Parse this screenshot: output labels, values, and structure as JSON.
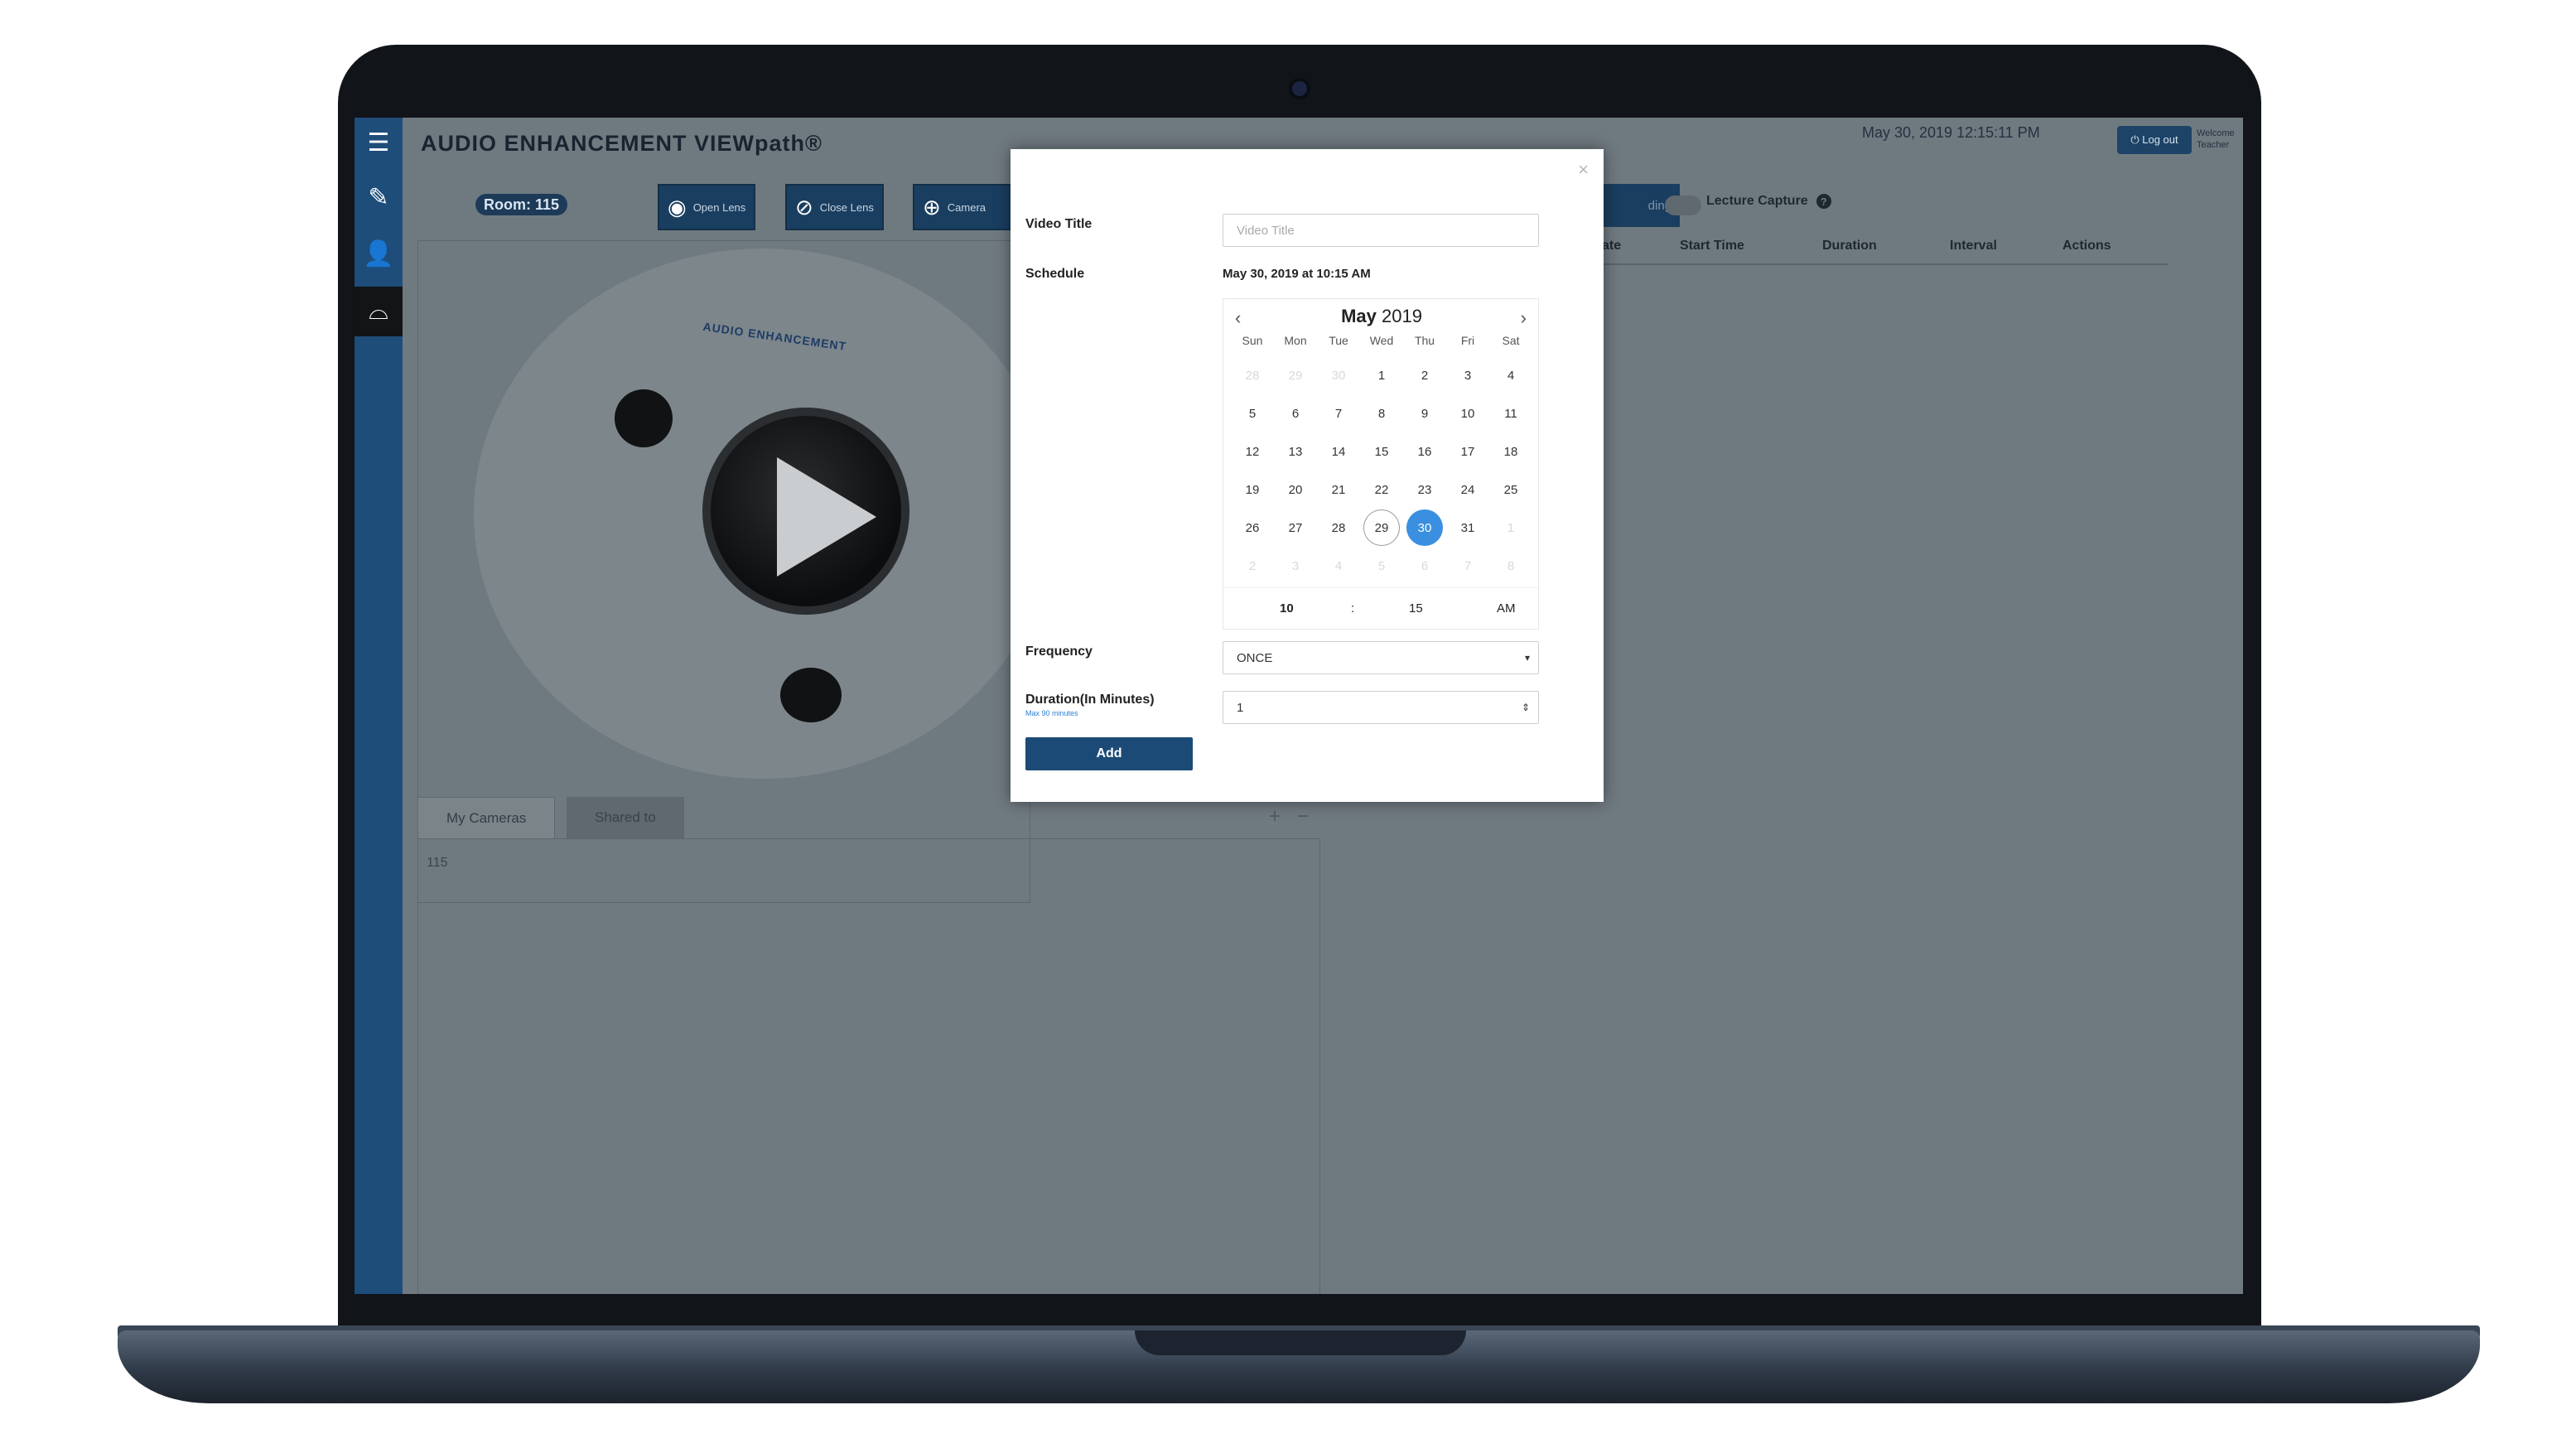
{
  "header": {
    "brand": "AUDIO ENHANCEMENT VIEWpath®",
    "datetime": "May 30, 2019 12:15:11 PM",
    "logout_label": "⏻ Log out",
    "welcome": "Welcome Teacher"
  },
  "sidebar": {
    "items": [
      {
        "name": "menu",
        "icon": "☰"
      },
      {
        "name": "edit",
        "icon": "✎"
      },
      {
        "name": "user",
        "icon": "👤"
      },
      {
        "name": "camera",
        "icon": "⌓"
      }
    ]
  },
  "toolbar": {
    "room": "Room: 115",
    "open_lens": "Open Lens",
    "close_lens": "Close Lens",
    "camera": "Camera",
    "recording": "ding"
  },
  "camera": {
    "brand": "AUDIO ENHANCEMENT"
  },
  "tabs": {
    "my_cameras": "My Cameras",
    "shared_to": "Shared to"
  },
  "camera_list": [
    "115"
  ],
  "schedule_panel": {
    "lecture_capture": "Lecture Capture",
    "columns": [
      "Date",
      "Start Time",
      "Duration",
      "Interval",
      "Actions"
    ],
    "columns_visible": [
      "ate",
      "Start Time",
      "Duration",
      "Interval",
      "Actions"
    ]
  },
  "modal": {
    "close": "×",
    "video_title_label": "Video Title",
    "video_title_placeholder": "Video Title",
    "schedule_label": "Schedule",
    "schedule_value": "May 30, 2019 at 10:15 AM",
    "calendar": {
      "month": "May",
      "year": "2019",
      "weekdays": [
        "Sun",
        "Mon",
        "Tue",
        "Wed",
        "Thu",
        "Fri",
        "Sat"
      ],
      "weeks": [
        [
          "28",
          "29",
          "30",
          "1",
          "2",
          "3",
          "4"
        ],
        [
          "5",
          "6",
          "7",
          "8",
          "9",
          "10",
          "11"
        ],
        [
          "12",
          "13",
          "14",
          "15",
          "16",
          "17",
          "18"
        ],
        [
          "19",
          "20",
          "21",
          "22",
          "23",
          "24",
          "25"
        ],
        [
          "26",
          "27",
          "28",
          "29",
          "30",
          "31",
          "1"
        ],
        [
          "2",
          "3",
          "4",
          "5",
          "6",
          "7",
          "8"
        ]
      ],
      "today": "29",
      "selected": "30",
      "hour": "10",
      "separator": ":",
      "minute": "15",
      "ampm": "AM"
    },
    "frequency_label": "Frequency",
    "frequency_value": "ONCE",
    "duration_label": "Duration(In Minutes)",
    "duration_hint": "Max 90 minutes",
    "duration_value": "1",
    "add_label": "Add"
  }
}
